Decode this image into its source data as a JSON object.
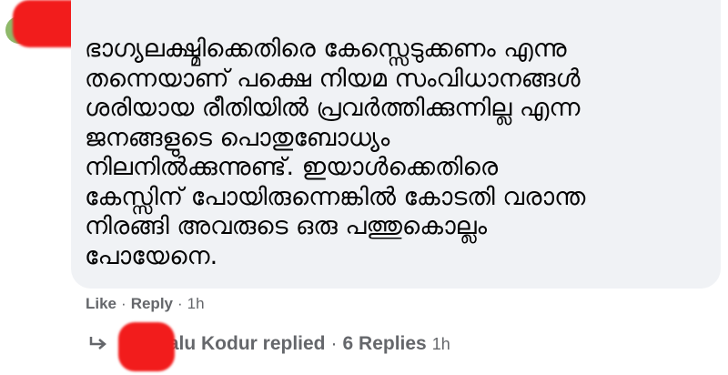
{
  "comment": {
    "text": "ഭാഗ്യലക്ഷ്മിക്കെതിരെ കേസ്സെടുക്കണം എന്നു\nതന്നെയാണ് പക്ഷെ നിയമ സംവിധാനങ്ങൾ\nശരിയായ രീതിയിൽ പ്രവർത്തിക്കുന്നില്ല എന്ന\nജനങ്ങളുടെ പൊതുബോധ്യം\nനിലനിൽക്കുന്നുണ്ട്. ഇയാൾക്കെതിരെ\nകേസ്സിന് പോയിരുന്നെങ്കിൽ കോടതി വരാന്ത\nനിരങ്ങി അവരുടെ ഒരു പത്തുകൊല്ലം\nപോയേനെ."
  },
  "actions": {
    "like": "Like",
    "reply": "Reply",
    "time": "1h",
    "separator": "·"
  },
  "replies": {
    "summary": "Lalu Kodur replied",
    "count_text": "6 Replies",
    "separator": "·",
    "time": "1h"
  },
  "colors": {
    "redaction": "#f21c1c",
    "bubble": "#f0f2f5",
    "meta_text": "#65676b"
  },
  "icons": {
    "reply": "reply-arrow-icon"
  }
}
